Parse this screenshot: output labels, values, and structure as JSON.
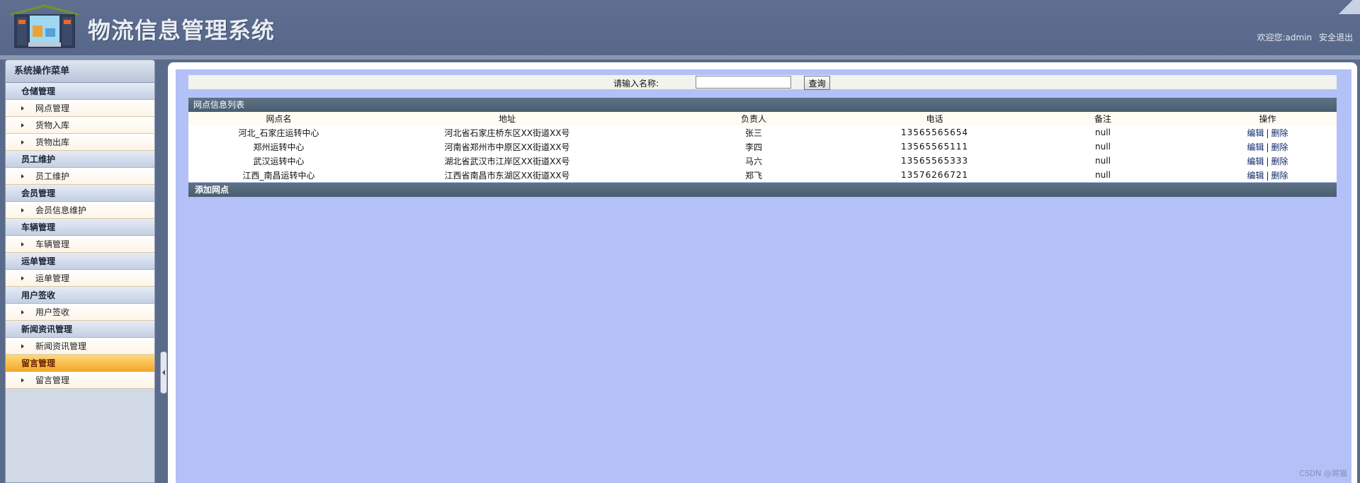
{
  "header": {
    "title": "物流信息管理系统",
    "welcome": "欢迎您:admin",
    "logout": "安全退出"
  },
  "sidebar": {
    "title": "系统操作菜单",
    "groups": [
      {
        "title": "仓储管理",
        "items": [
          "网点管理",
          "货物入库",
          "货物出库"
        ]
      },
      {
        "title": "员工维护",
        "items": [
          "员工维护"
        ]
      },
      {
        "title": "会员管理",
        "items": [
          "会员信息维护"
        ]
      },
      {
        "title": "车辆管理",
        "items": [
          "车辆管理"
        ]
      },
      {
        "title": "运单管理",
        "items": [
          "运单管理"
        ]
      },
      {
        "title": "用户签收",
        "items": [
          "用户签收"
        ]
      },
      {
        "title": "新闻资讯管理",
        "items": [
          "新闻资讯管理"
        ]
      },
      {
        "title": "留言管理",
        "items": [
          "留言管理"
        ],
        "active": true
      }
    ]
  },
  "search": {
    "label": "请输入名称:",
    "value": "",
    "button": "查询"
  },
  "table": {
    "title": "网点信息列表",
    "columns": [
      "网点名",
      "地址",
      "负责人",
      "电话",
      "备注",
      "操作"
    ],
    "rows": [
      {
        "name": "河北_石家庄运转中心",
        "address": "河北省石家庄桥东区XX街道XX号",
        "manager": "张三",
        "phone": "13565565654",
        "note": "null"
      },
      {
        "name": "郑州运转中心",
        "address": "河南省郑州市中原区XX街道XX号",
        "manager": "李四",
        "phone": "13565565111",
        "note": "null"
      },
      {
        "name": "武汉运转中心",
        "address": "湖北省武汉市江岸区XX街道XX号",
        "manager": "马六",
        "phone": "13565565333",
        "note": "null"
      },
      {
        "name": "江西_南昌运转中心",
        "address": "江西省南昌市东湖区XX街道XX号",
        "manager": "郑飞",
        "phone": "13576266721",
        "note": "null"
      }
    ],
    "edit_label": "编辑",
    "separator": "|",
    "delete_label": "删除",
    "add_label": "添加网点"
  },
  "watermark": "CSDN @屌猫"
}
